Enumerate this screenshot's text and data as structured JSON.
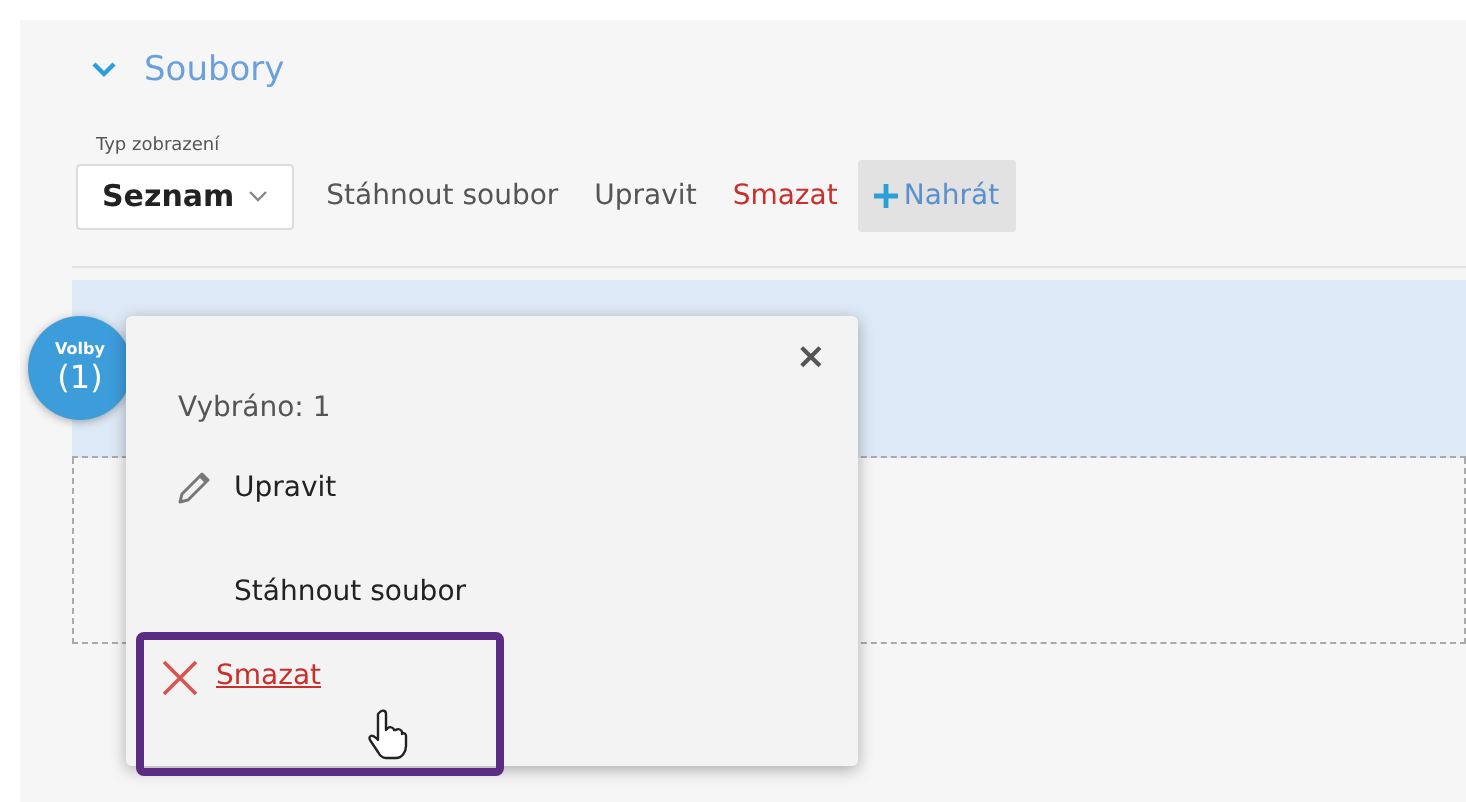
{
  "section": {
    "title": "Soubory",
    "expanded": true
  },
  "view_type": {
    "label": "Typ zobrazení",
    "value": "Seznam"
  },
  "toolbar": [
    {
      "label": "Stáhnout soubor",
      "kind": "default"
    },
    {
      "label": "Upravit",
      "kind": "default"
    },
    {
      "label": "Smazat",
      "kind": "danger"
    },
    {
      "label": "Nahrát",
      "kind": "upload"
    }
  ],
  "options_badge": {
    "label": "Volby",
    "count": "(1)"
  },
  "popup": {
    "close": "×",
    "selected_info": "Vybráno: 1",
    "items": [
      {
        "label": "Upravit",
        "kind": "edit",
        "highlighted": false
      },
      {
        "label": "Stáhnout soubor",
        "kind": "download",
        "highlighted": false
      },
      {
        "label": "Smazat",
        "kind": "delete",
        "highlighted": true
      }
    ]
  }
}
